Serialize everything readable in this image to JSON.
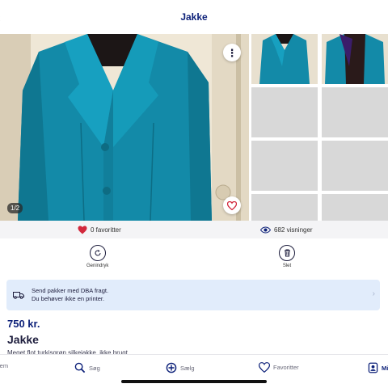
{
  "header": {
    "title": "Jakke"
  },
  "gallery": {
    "counter": "1/2",
    "photo_alt": "Turquoise silk jacket on mannequin"
  },
  "stats": {
    "favorites": "0 favoritter",
    "views": "682 visninger"
  },
  "actions": [
    {
      "label": "Genindryk"
    },
    {
      "label": "Slet"
    }
  ],
  "banner": {
    "line1": "Send pakker med DBA fragt.",
    "line2": "Du behøver ikke en printer."
  },
  "listing": {
    "price": "750 kr.",
    "title": "Jakke",
    "description": "Meget flot turkisgrøn silkejakke, ikke brugt"
  },
  "tabbar": {
    "items": [
      {
        "label": "jem",
        "icon": "home-icon"
      },
      {
        "label": "Søg",
        "icon": "search-icon"
      },
      {
        "label": "Sælg",
        "icon": "sell-plus-icon"
      },
      {
        "label": "Favoritter",
        "icon": "heart-icon"
      },
      {
        "label": "Mi",
        "icon": "profile-icon"
      }
    ]
  },
  "colors": {
    "brand_navy": "#0b1f78",
    "heart_red": "#d2283c",
    "jacket_teal": "#138aa8",
    "banner_bg": "#e1ecfb"
  }
}
